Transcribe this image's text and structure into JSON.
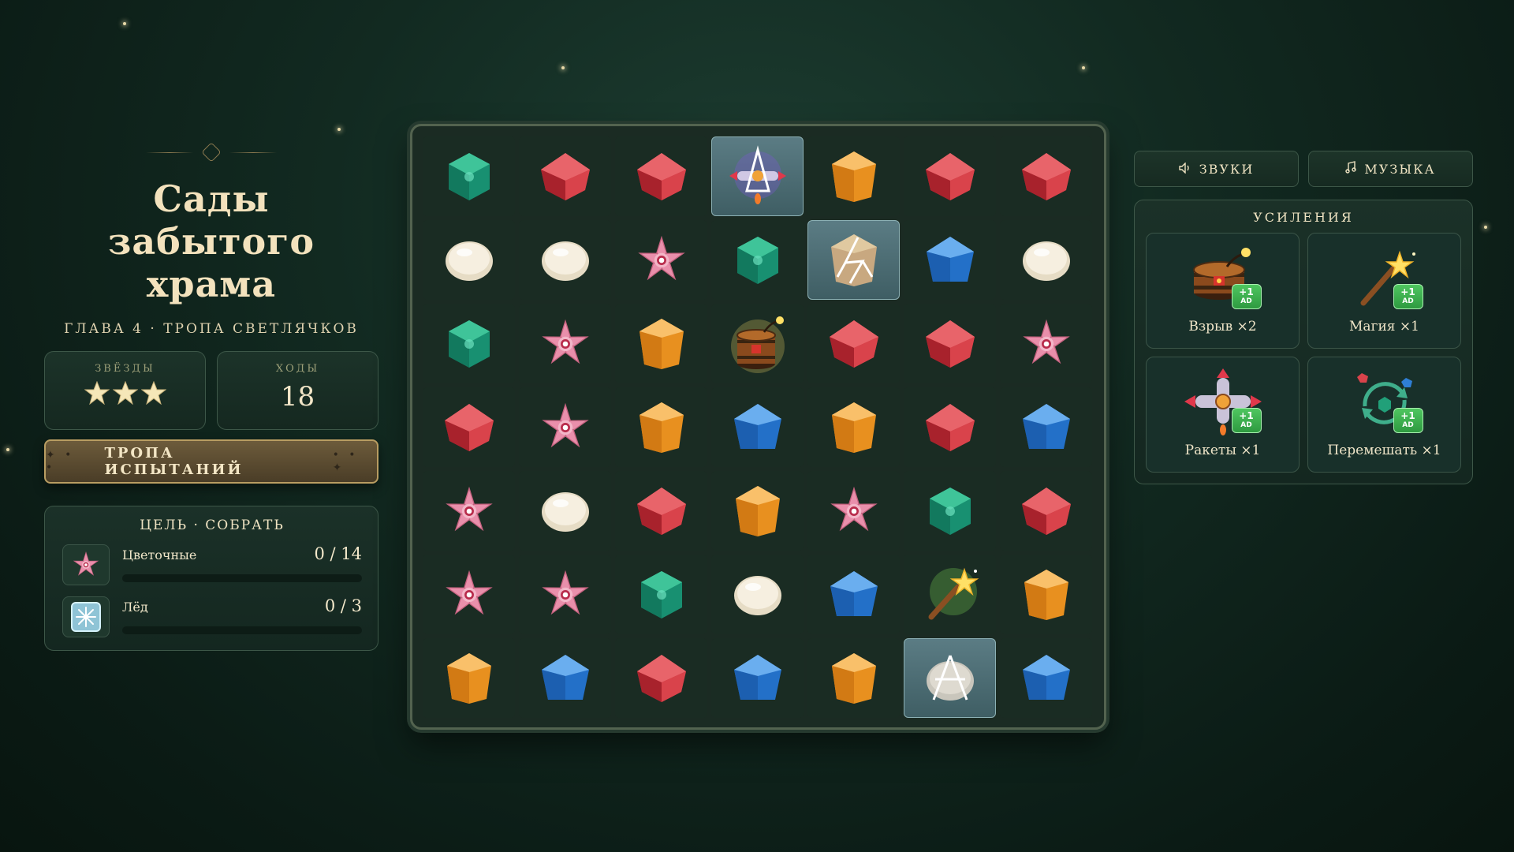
{
  "level": {
    "title_line1": "Сады забытого",
    "title_line2": "храма",
    "subtitle": "ГЛАВА 4 · ТРОПА СВЕТЛЯЧКОВ"
  },
  "stats": {
    "stars_label": "ЗВЁЗДЫ",
    "stars_value": 3,
    "moves_label": "ХОДЫ",
    "moves_value": "18"
  },
  "trial_button": {
    "label": "ТРОПА ИСПЫТАНИЙ"
  },
  "goal": {
    "heading": "ЦЕЛЬ · СОБРАТЬ",
    "items": [
      {
        "name": "Цветочные",
        "count": "0 / 14",
        "progress": 0,
        "icon": "flower-icon"
      },
      {
        "name": "Лёд",
        "count": "0 / 3",
        "progress": 0,
        "icon": "ice-icon"
      }
    ]
  },
  "board": {
    "rows": [
      [
        "green",
        "red",
        "red",
        "rocket",
        "orange",
        "red",
        "red"
      ],
      [
        "pearl",
        "pearl",
        "flower",
        "green",
        "orange-ice",
        "blue",
        "pearl"
      ],
      [
        "green",
        "flower",
        "orange",
        "bomb",
        "red",
        "red",
        "flower"
      ],
      [
        "red",
        "flower",
        "orange",
        "blue",
        "orange",
        "red",
        "blue"
      ],
      [
        "flower",
        "pearl",
        "red",
        "orange",
        "flower",
        "green",
        "red"
      ],
      [
        "flower",
        "flower",
        "green",
        "pearl",
        "blue",
        "wand",
        "orange"
      ],
      [
        "orange",
        "blue",
        "red",
        "blue",
        "orange",
        "pearl-ice",
        "blue"
      ]
    ]
  },
  "controls": {
    "sounds_label": "ЗВУКИ",
    "music_label": "МУЗЫКА"
  },
  "boosters": {
    "heading": "УСИЛЕНИЯ",
    "ad_plus": "+1",
    "ad_tag": "AD",
    "items": [
      {
        "label": "Взрыв ×2",
        "icon": "bomb-barrel-icon"
      },
      {
        "label": "Магия ×1",
        "icon": "magic-wand-icon"
      },
      {
        "label": "Ракеты ×1",
        "icon": "rocket-icon"
      },
      {
        "label": "Перемешать ×1",
        "icon": "shuffle-icon"
      }
    ]
  },
  "colors": {
    "background": "#122a21",
    "accent_gold": "#b99d62",
    "gem_red": "#d9434b",
    "gem_green": "#21a079",
    "gem_blue": "#2f7fd6",
    "gem_orange": "#f0a238",
    "flower_pink": "#e88ca8",
    "ad_green": "#3fb552"
  }
}
